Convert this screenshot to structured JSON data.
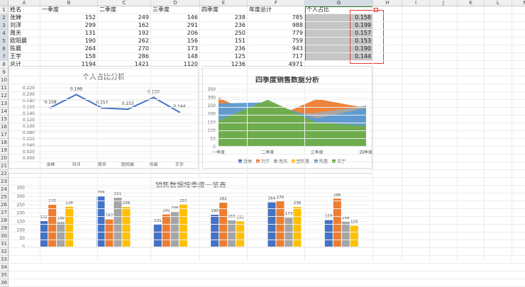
{
  "sheet": {
    "columns": [
      "A",
      "B",
      "C",
      "D",
      "E",
      "F",
      "G",
      "H",
      "I",
      "J",
      "K",
      "L",
      "M"
    ],
    "rows": [
      "1",
      "2",
      "3",
      "4",
      "5",
      "6",
      "7",
      "8",
      "9",
      "10",
      "11",
      "12",
      "13",
      "14",
      "15",
      "16",
      "17",
      "18",
      "19",
      "20",
      "21",
      "22",
      "23",
      "24",
      "25",
      "26",
      "27",
      "28",
      "29",
      "30",
      "31",
      "32",
      "33",
      "34",
      "35",
      "36"
    ],
    "header_row": [
      "姓名",
      "一季度",
      "二季度",
      "三季度",
      "四季度",
      "年度总计",
      "个人占比"
    ],
    "data_rows": [
      [
        "张婵",
        "152",
        "249",
        "146",
        "238",
        "785",
        "0.158"
      ],
      [
        "刘洋",
        "299",
        "162",
        "291",
        "236",
        "988",
        "0.199"
      ],
      [
        "周天",
        "131",
        "192",
        "206",
        "250",
        "779",
        "0.157"
      ],
      [
        "欧阳晨",
        "190",
        "262",
        "156",
        "151",
        "759",
        "0.153"
      ],
      [
        "陈晨",
        "264",
        "270",
        "173",
        "236",
        "943",
        "0.190"
      ],
      [
        "王宇",
        "158",
        "286",
        "148",
        "125",
        "717",
        "0.144"
      ]
    ],
    "total_row": [
      "总计",
      "1194",
      "1421",
      "1120",
      "1236",
      "4971",
      ""
    ]
  },
  "chart1": {
    "chart_data": {
      "type": "line",
      "title": "个人占比分析",
      "categories": [
        "张婵",
        "刘洋",
        "周天",
        "欧阳晨",
        "陈晨",
        "王宇"
      ],
      "values": [
        0.158,
        0.199,
        0.157,
        0.153,
        0.19,
        0.144
      ],
      "value_labels": [
        "0.158",
        "0.199",
        "0.157",
        "0.153",
        "0.190",
        "0.144"
      ],
      "yticks": [
        "0.000",
        "0.020",
        "0.040",
        "0.060",
        "0.080",
        "0.100",
        "0.120",
        "0.140",
        "0.160",
        "0.180",
        "0.200",
        "0.220"
      ],
      "ylim": [
        0,
        0.22
      ],
      "color": "#4472c4"
    }
  },
  "chart2": {
    "chart_data": {
      "type": "area",
      "title": "四季度销售数据分析",
      "categories": [
        "一季度",
        "二季度",
        "三季度",
        "四季度"
      ],
      "ylim": [
        0,
        350
      ],
      "yticks": [
        "0",
        "50",
        "100",
        "150",
        "200",
        "250",
        "300",
        "350"
      ],
      "series": [
        {
          "name": "张婵",
          "values": [
            152,
            249,
            146,
            238
          ],
          "color": "#4472c4"
        },
        {
          "name": "刘洋",
          "values": [
            299,
            162,
            291,
            236
          ],
          "color": "#ed7d31"
        },
        {
          "name": "周天",
          "values": [
            131,
            192,
            206,
            250
          ],
          "color": "#a5a5a5"
        },
        {
          "name": "欧阳晨",
          "values": [
            190,
            262,
            156,
            151
          ],
          "color": "#ffc000"
        },
        {
          "name": "陈晨",
          "values": [
            264,
            270,
            173,
            236
          ],
          "color": "#5b9bd5"
        },
        {
          "name": "王宇",
          "values": [
            158,
            286,
            148,
            125
          ],
          "color": "#70ad47"
        }
      ]
    }
  },
  "chart3": {
    "chart_data": {
      "type": "bar",
      "title": "销售数据按季度一览表",
      "categories": [
        "张婵",
        "刘洋",
        "周天",
        "欧阳晨",
        "陈晨",
        "王宇"
      ],
      "ylim": [
        0,
        350
      ],
      "yticks": [
        "0",
        "50",
        "100",
        "150",
        "200",
        "250",
        "300",
        "350"
      ],
      "series": [
        {
          "name": "一季度",
          "values": [
            152,
            299,
            131,
            190,
            264,
            158
          ],
          "color": "#4472c4"
        },
        {
          "name": "二季度",
          "values": [
            249,
            162,
            192,
            262,
            270,
            286
          ],
          "color": "#ed7d31"
        },
        {
          "name": "三季度",
          "values": [
            146,
            291,
            206,
            156,
            173,
            148
          ],
          "color": "#a5a5a5"
        },
        {
          "name": "四季度",
          "values": [
            238,
            236,
            250,
            151,
            236,
            125
          ],
          "color": "#ffc000"
        }
      ]
    }
  }
}
